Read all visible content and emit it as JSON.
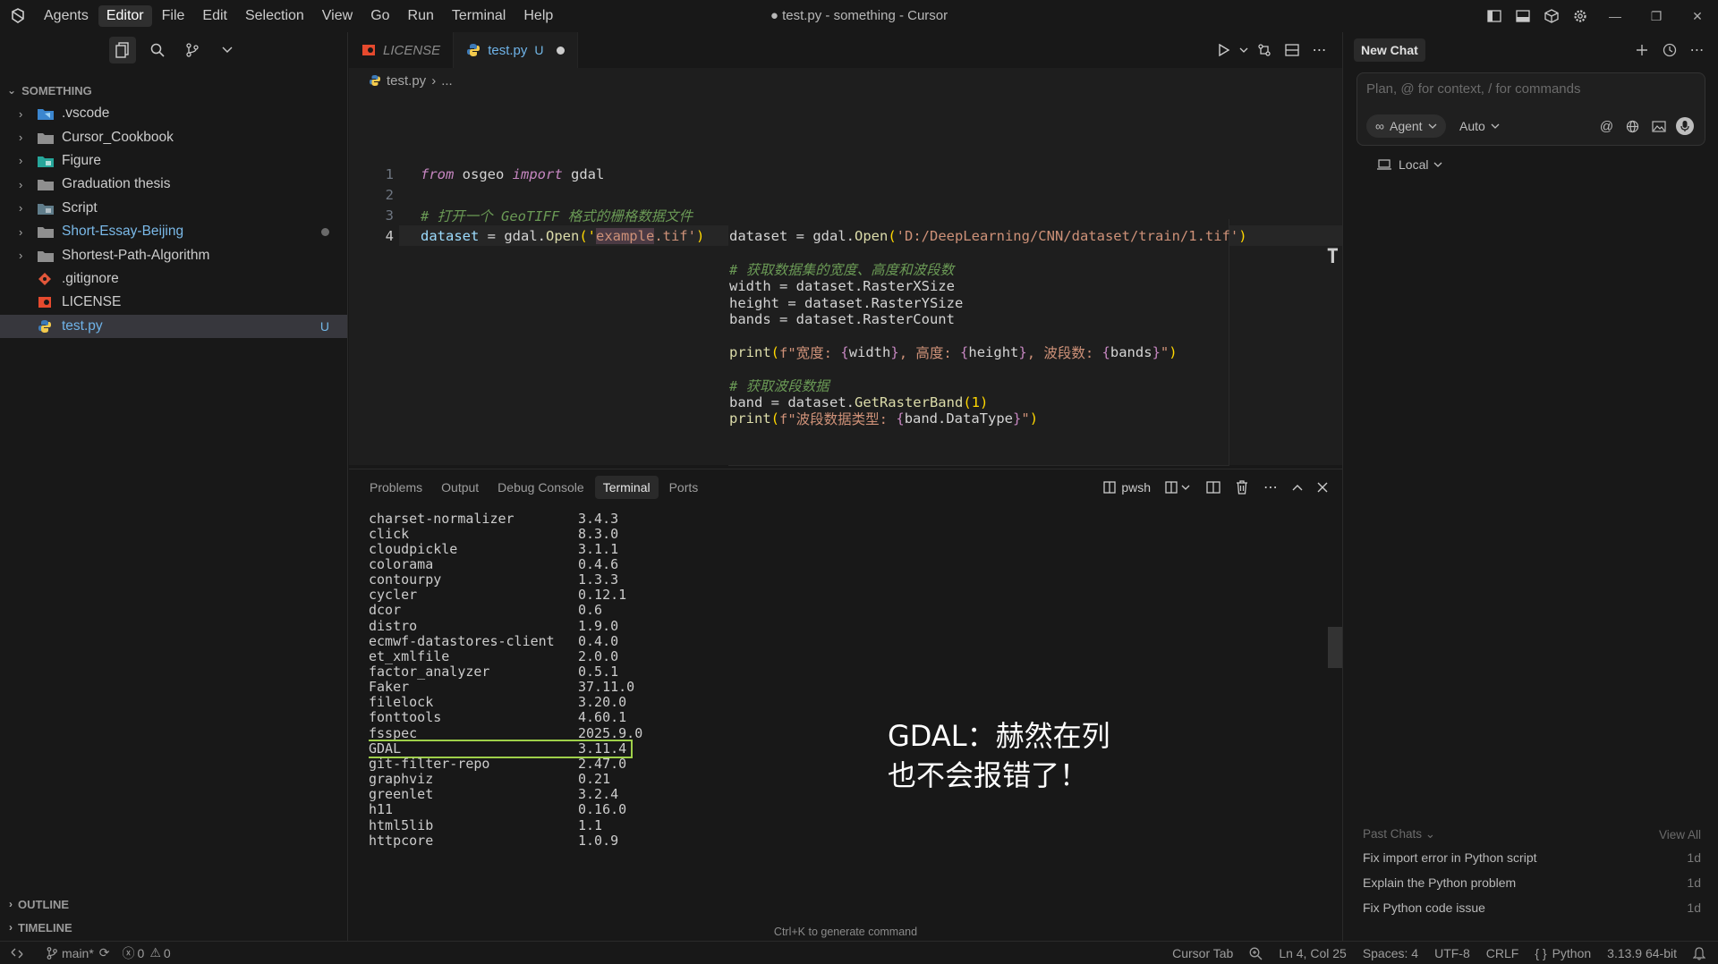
{
  "window": {
    "title": "● test.py - something - Cursor"
  },
  "menu": [
    "Agents",
    "Editor",
    "File",
    "Edit",
    "Selection",
    "View",
    "Go",
    "Run",
    "Terminal",
    "Help"
  ],
  "explorer": {
    "section": "SOMETHING",
    "items": [
      {
        "label": ".vscode"
      },
      {
        "label": "Cursor_Cookbook"
      },
      {
        "label": "Figure"
      },
      {
        "label": "Graduation thesis"
      },
      {
        "label": "Script"
      },
      {
        "label": "Short-Essay-Beijing"
      },
      {
        "label": "Shortest-Path-Algorithm"
      },
      {
        "label": ".gitignore"
      },
      {
        "label": "LICENSE"
      },
      {
        "label": "test.py",
        "badge": "U"
      }
    ],
    "outline": "OUTLINE",
    "timeline": "TIMELINE"
  },
  "tabs": [
    {
      "label": "LICENSE"
    },
    {
      "label": "test.py",
      "status": "U"
    }
  ],
  "breadcrumb": {
    "file": "test.py",
    "rest": "..."
  },
  "code": {
    "line_numbers": [
      "1",
      "2",
      "3",
      "4"
    ],
    "l1_from": "from",
    "l1_mod": " osgeo ",
    "l1_import": "import",
    "l1_name": " gdal",
    "l3_comment": "# 打开一个 GeoTIFF 格式的栅格数据文件",
    "l4_var": "dataset",
    "l4_eq": " = gdal.",
    "l4_fn": "Open",
    "l4_open": "('",
    "l4_hl": "example",
    "l4_rest": ".tif'",
    "l4_close": ")"
  },
  "suggestion": {
    "s1_a": "dataset = gdal.",
    "s1_fn": "Open",
    "s1_p": "(",
    "s1_str": "'D:/DeepLearning/CNN/dataset/train/1.tif'",
    "s1_pc": ")",
    "s3": "# 获取数据集的宽度、高度和波段数",
    "s4": "width = dataset.RasterXSize",
    "s5": "height = dataset.RasterYSize",
    "s6": "bands = dataset.RasterCount",
    "s8_fn": "print",
    "s8_p": "(",
    "s8_f": "f\"宽度: ",
    "s8_b1": "{",
    "s8_v1": "width",
    "s8_b1c": "}",
    "s8_t2": ", 高度: ",
    "s8_b2": "{",
    "s8_v2": "height",
    "s8_b2c": "}",
    "s8_t3": ", 波段数: ",
    "s8_b3": "{",
    "s8_v3": "bands",
    "s8_b3c": "}",
    "s8_end": "\"",
    "s8_pc": ")",
    "s10": "# 获取波段数据",
    "s11_a": "band = dataset.",
    "s11_fn": "GetRasterBand",
    "s11_p": "(1)",
    "s12_fn": "print",
    "s12_p": "(",
    "s12_f": "f\"波段数据类型: ",
    "s12_b": "{",
    "s12_v": "band.DataType",
    "s12_bc": "}",
    "s12_end": "\"",
    "s12_pc": ")",
    "ghost_marker": "T"
  },
  "panel": {
    "tabs": [
      "Problems",
      "Output",
      "Debug Console",
      "Terminal",
      "Ports"
    ],
    "shell": "pwsh",
    "hint": "Ctrl+K to generate command"
  },
  "terminal_rows": [
    {
      "name": "charset-normalizer",
      "version": "3.4.3"
    },
    {
      "name": "click",
      "version": "8.3.0"
    },
    {
      "name": "cloudpickle",
      "version": "3.1.1"
    },
    {
      "name": "colorama",
      "version": "0.4.6"
    },
    {
      "name": "contourpy",
      "version": "1.3.3"
    },
    {
      "name": "cycler",
      "version": "0.12.1"
    },
    {
      "name": "dcor",
      "version": "0.6"
    },
    {
      "name": "distro",
      "version": "1.9.0"
    },
    {
      "name": "ecmwf-datastores-client",
      "version": "0.4.0"
    },
    {
      "name": "et_xmlfile",
      "version": "2.0.0"
    },
    {
      "name": "factor_analyzer",
      "version": "0.5.1"
    },
    {
      "name": "Faker",
      "version": "37.11.0"
    },
    {
      "name": "filelock",
      "version": "3.20.0"
    },
    {
      "name": "fonttools",
      "version": "4.60.1"
    },
    {
      "name": "fsspec",
      "version": "2025.9.0"
    },
    {
      "name": "GDAL",
      "version": "3.11.4",
      "highlighted": true
    },
    {
      "name": "git-filter-repo",
      "version": "2.47.0"
    },
    {
      "name": "graphviz",
      "version": "0.21"
    },
    {
      "name": "greenlet",
      "version": "3.2.4"
    },
    {
      "name": "h11",
      "version": "0.16.0"
    },
    {
      "name": "html5lib",
      "version": "1.1"
    },
    {
      "name": "httpcore",
      "version": "1.0.9"
    }
  ],
  "overlay_note": {
    "line1": "GDAL：赫然在列",
    "line2": "也不会报错了！"
  },
  "chat": {
    "tab": "New Chat",
    "placeholder": "Plan, @ for context, / for commands",
    "agent": "Agent",
    "model": "Auto",
    "local": "Local",
    "past_chats": "Past Chats",
    "view_all": "View All",
    "history": [
      {
        "title": "Fix import error in Python script",
        "age": "1d"
      },
      {
        "title": "Explain the Python problem",
        "age": "1d"
      },
      {
        "title": "Fix Python code issue",
        "age": "1d"
      }
    ]
  },
  "status": {
    "branch": "main*",
    "errors": "0",
    "warnings": "0",
    "cursor_tab": "Cursor Tab",
    "position": "Ln 4, Col 25",
    "spaces": "Spaces: 4",
    "encoding": "UTF-8",
    "eol": "CRLF",
    "language": "Python",
    "interpreter": "3.13.9 64-bit"
  },
  "colors": {
    "accent": "#6fb3e8",
    "highlight_box": "#9fd04a",
    "background": "#181818"
  }
}
